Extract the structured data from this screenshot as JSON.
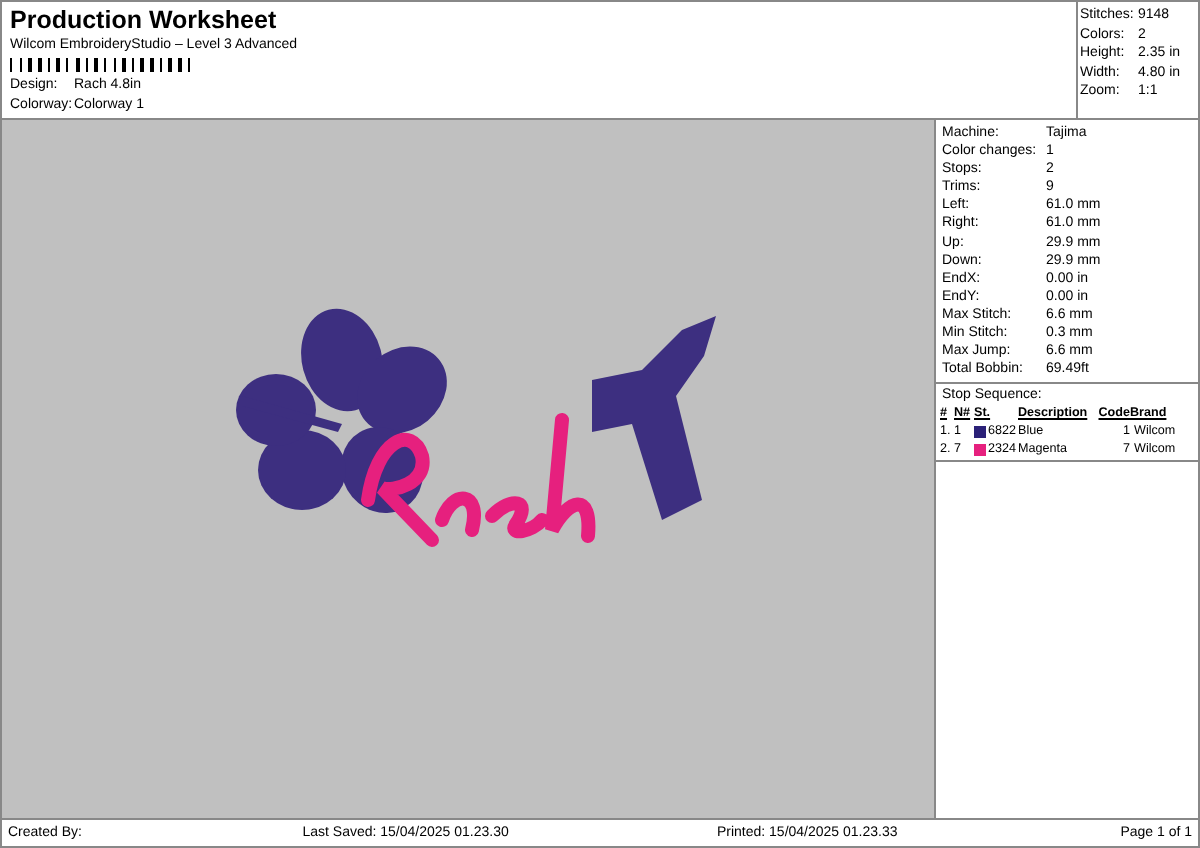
{
  "header": {
    "title": "Production Worksheet",
    "subtitle": "Wilcom EmbroideryStudio – Level 3 Advanced",
    "fields": [
      {
        "label": "Design:",
        "value": "Rach 4.8in"
      },
      {
        "label": "Colorway:",
        "value": "Colorway 1"
      }
    ]
  },
  "summary": [
    {
      "label": "Stitches:",
      "value": "9148"
    },
    {
      "label": "Colors:",
      "value": "2"
    },
    {
      "label": "Height:",
      "value": "2.35 in"
    },
    {
      "label": "Width:",
      "value": "4.80 in"
    },
    {
      "label": "Zoom:",
      "value": "1:1"
    }
  ],
  "details": [
    {
      "label": "Machine:",
      "value": "Tajima"
    },
    {
      "label": "Color changes:",
      "value": "1"
    },
    {
      "label": "Stops:",
      "value": "2"
    },
    {
      "label": "Trims:",
      "value": "9"
    },
    {
      "label": "Left:",
      "value": "61.0 mm"
    },
    {
      "label": "Right:",
      "value": "61.0 mm"
    },
    {
      "label": "Up:",
      "value": "29.9 mm"
    },
    {
      "label": "Down:",
      "value": "29.9 mm"
    },
    {
      "label": "EndX:",
      "value": "0.00 in"
    },
    {
      "label": "EndY:",
      "value": "0.00 in"
    },
    {
      "label": "Max Stitch:",
      "value": "6.6 mm"
    },
    {
      "label": "Min Stitch:",
      "value": "0.3 mm"
    },
    {
      "label": "Max Jump:",
      "value": "6.6 mm"
    },
    {
      "label": "Total Bobbin:",
      "value": "69.49ft"
    }
  ],
  "stop_sequence": {
    "title": "Stop Sequence:",
    "columns": [
      "#",
      "N#",
      "St.",
      "Description",
      "Code",
      "Brand"
    ],
    "rows": [
      {
        "index": "1.",
        "needle": "1",
        "color": "#2b2178",
        "stitches": "6822",
        "description": "Blue",
        "code": "1",
        "brand": "Wilcom"
      },
      {
        "index": "2.",
        "needle": "7",
        "color": "#e6207e",
        "stitches": "2324",
        "description": "Magenta",
        "code": "7",
        "brand": "Wilcom"
      }
    ]
  },
  "footer": {
    "created_by": "Created By:",
    "last_saved": "Last Saved: 15/04/2025 01.23.30",
    "printed": "Printed: 15/04/2025 01.23.33",
    "page": "Page 1 of 1"
  }
}
